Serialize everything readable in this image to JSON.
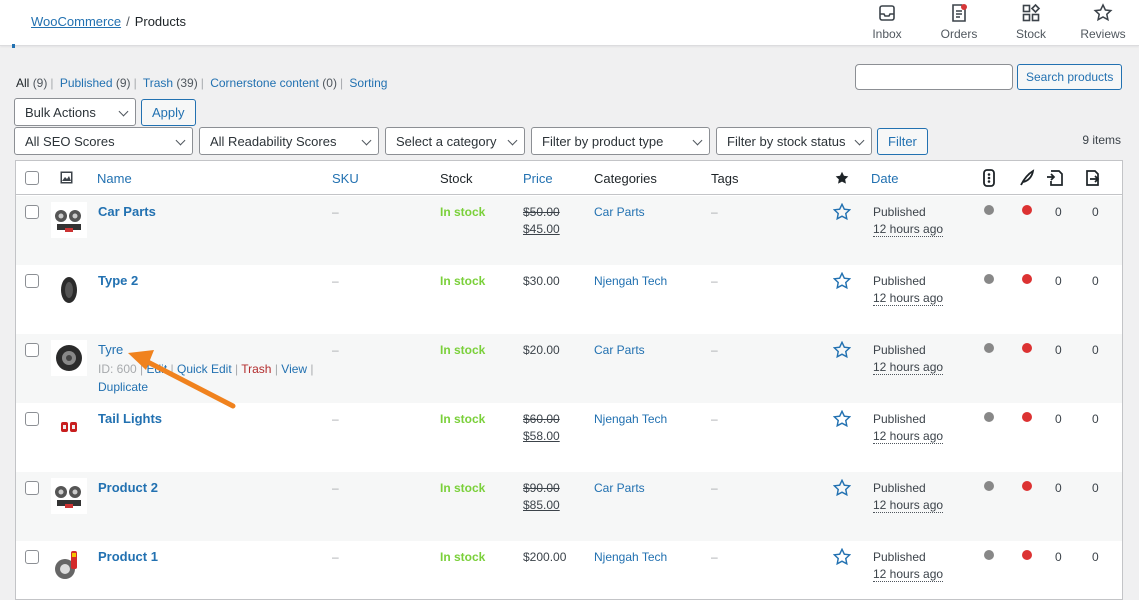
{
  "breadcrumb": {
    "parent": "WooCommerce",
    "sep": "/",
    "current": "Products"
  },
  "top_actions": [
    {
      "label": "Inbox",
      "icon": "inbox-icon"
    },
    {
      "label": "Orders",
      "icon": "orders-icon"
    },
    {
      "label": "Stock",
      "icon": "stock-icon"
    },
    {
      "label": "Reviews",
      "icon": "reviews-icon"
    }
  ],
  "filters_nav": {
    "all": "All",
    "all_count": "(9)",
    "published": "Published",
    "published_count": "(9)",
    "trash": "Trash",
    "trash_count": "(39)",
    "cornerstone": "Cornerstone content",
    "cornerstone_count": "(0)",
    "sorting": "Sorting"
  },
  "search": {
    "placeholder": "",
    "button": "Search products"
  },
  "bulk": {
    "selected": "Bulk Actions",
    "apply": "Apply"
  },
  "dropdowns": {
    "seo": "All SEO Scores",
    "readability": "All Readability Scores",
    "category": "Select a category",
    "product_type": "Filter by product type",
    "stock_status": "Filter by stock status",
    "filter_button": "Filter"
  },
  "items_count": "9 items",
  "columns": {
    "name": "Name",
    "sku": "SKU",
    "stock": "Stock",
    "price": "Price",
    "categories": "Categories",
    "tags": "Tags",
    "date": "Date"
  },
  "products": [
    {
      "name": "Car Parts",
      "sku": "–",
      "stock": "In stock",
      "price_old": "$50.00",
      "price_new": "$45.00",
      "category": "Car Parts",
      "tags": "–",
      "status": "Published",
      "ago": "12 hours ago",
      "c1": "0",
      "c2": "0"
    },
    {
      "name": "Type 2",
      "sku": "–",
      "stock": "In stock",
      "price_old": "",
      "price_new": "$30.00",
      "category": "Njengah Tech",
      "tags": "–",
      "status": "Published",
      "ago": "12 hours ago",
      "c1": "0",
      "c2": "0"
    },
    {
      "name": "Tyre",
      "sku": "–",
      "stock": "In stock",
      "price_old": "",
      "price_new": "$20.00",
      "category": "Car Parts",
      "tags": "–",
      "status": "Published",
      "ago": "12 hours ago",
      "c1": "0",
      "c2": "0",
      "actions": {
        "id": "ID: 600",
        "edit": "Edit",
        "quick_edit": "Quick Edit",
        "trash": "Trash",
        "view": "View",
        "duplicate": "Duplicate"
      }
    },
    {
      "name": "Tail Lights",
      "sku": "–",
      "stock": "In stock",
      "price_old": "$60.00",
      "price_new": "$58.00",
      "category": "Njengah Tech",
      "tags": "–",
      "status": "Published",
      "ago": "12 hours ago",
      "c1": "0",
      "c2": "0"
    },
    {
      "name": "Product 2",
      "sku": "–",
      "stock": "In stock",
      "price_old": "$90.00",
      "price_new": "$85.00",
      "category": "Car Parts",
      "tags": "–",
      "status": "Published",
      "ago": "12 hours ago",
      "c1": "0",
      "c2": "0"
    },
    {
      "name": "Product 1",
      "sku": "–",
      "stock": "In stock",
      "price_old": "",
      "price_new": "$200.00",
      "category": "Njengah Tech",
      "tags": "–",
      "status": "Published",
      "ago": "12 hours ago",
      "c1": "0",
      "c2": "0"
    }
  ],
  "colors": {
    "link": "#2271b1",
    "in_stock": "#7ad03a",
    "seo_dot": "#888888",
    "readability_dot": "#dc3232",
    "arrow": "#f0821e"
  }
}
